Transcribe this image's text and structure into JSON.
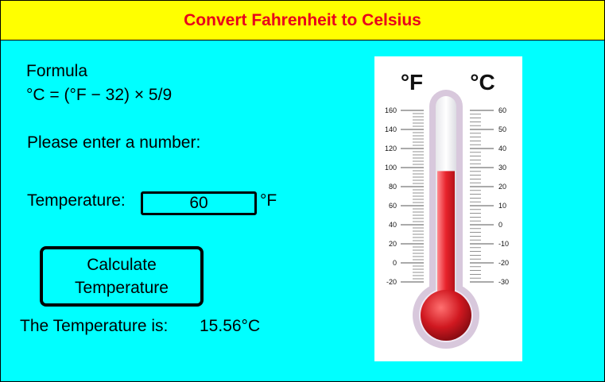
{
  "header": {
    "title": "Convert Fahrenheit to Celsius"
  },
  "formula": {
    "heading": "Formula",
    "expression": "°C = (°F − 32) × 5/9"
  },
  "prompt": "Please enter a number:",
  "input": {
    "label": "Temperature:",
    "value": "60",
    "unit": "°F"
  },
  "button": {
    "line1": "Calculate",
    "line2": "Temperature"
  },
  "result": {
    "label": "The Temperature is:",
    "value": "15.56°C"
  },
  "thermometer": {
    "f_label": "°F",
    "c_label": "°C",
    "f_ticks": [
      "160",
      "140",
      "120",
      "100",
      "80",
      "60",
      "40",
      "20",
      "0",
      "-20"
    ],
    "c_ticks": [
      "60",
      "50",
      "40",
      "30",
      "20",
      "10",
      "0",
      "-10",
      "-20",
      "-30"
    ],
    "fill_fraction": 0.66,
    "colors": {
      "tube": "#f2f2f2",
      "liquid": "#e8232b",
      "bulb": "#c8101a",
      "outline": "#d8c8dc"
    }
  },
  "colors": {
    "background": "#00ffff",
    "header_bg": "#ffff00",
    "header_text": "#e8001c"
  }
}
